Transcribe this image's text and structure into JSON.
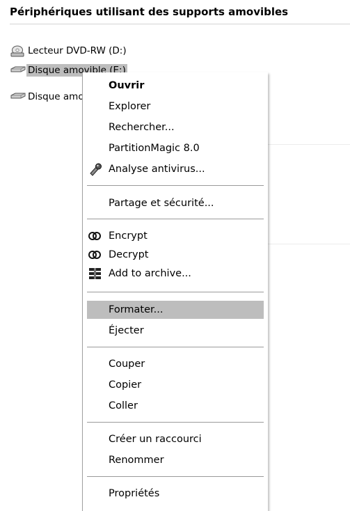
{
  "header": {
    "title": "Périphériques utilisant des supports amovibles"
  },
  "drives": [
    {
      "label": "Lecteur DVD-RW (D:)",
      "icon": "dvd-drive-icon"
    },
    {
      "label": "Disque amovible (E:)",
      "icon": "removable-disk-icon",
      "selected": true
    },
    {
      "label": "Disque amovible (F:)",
      "icon": "removable-disk-icon"
    }
  ],
  "context_menu": {
    "items": {
      "ouvrir": "Ouvrir",
      "explorer": "Explorer",
      "rechercher": "Rechercher...",
      "partitionmagic": "PartitionMagic 8.0",
      "analyse_antivirus": "Analyse antivirus...",
      "partage_securite": "Partage et sécurité...",
      "encrypt": "Encrypt",
      "decrypt": "Decrypt",
      "add_to_archive": "Add to archive...",
      "formater": "Formater...",
      "ejecter": "Éjecter",
      "couper": "Couper",
      "copier": "Copier",
      "coller": "Coller",
      "creer_raccourci": "Créer un raccourci",
      "renommer": "Renommer",
      "proprietes": "Propriétés"
    },
    "highlighted": "formater"
  },
  "colors": {
    "highlight": "#bdbdbd",
    "separator": "#9a9a9a"
  }
}
